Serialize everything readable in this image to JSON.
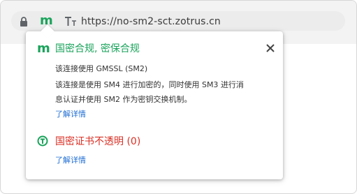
{
  "address_bar": {
    "url": "https://no-sm2-sct.zotrus.cn",
    "sm_badge": "m",
    "lock_icon": "lock-icon",
    "text_icon": "text-size-icon"
  },
  "popup": {
    "title_icon": "m",
    "title": "国密合规, 密保合规",
    "close_icon": "close-icon",
    "lines": [
      "该连接使用 GMSSL (SM2)",
      "该连接是使用 SM4 进行加密的，同时使用 SM3 进行消",
      "息认证并使用 SM2 作为密钥交换机制。"
    ],
    "learn_more_1": "了解详情",
    "section2_icon": "transparency-icon",
    "section2_title": "国密证书不透明 (0)",
    "learn_more_2": "了解详情"
  },
  "colors": {
    "green": "#1aa35b",
    "red": "#d93025",
    "link": "#1f6ed4"
  }
}
